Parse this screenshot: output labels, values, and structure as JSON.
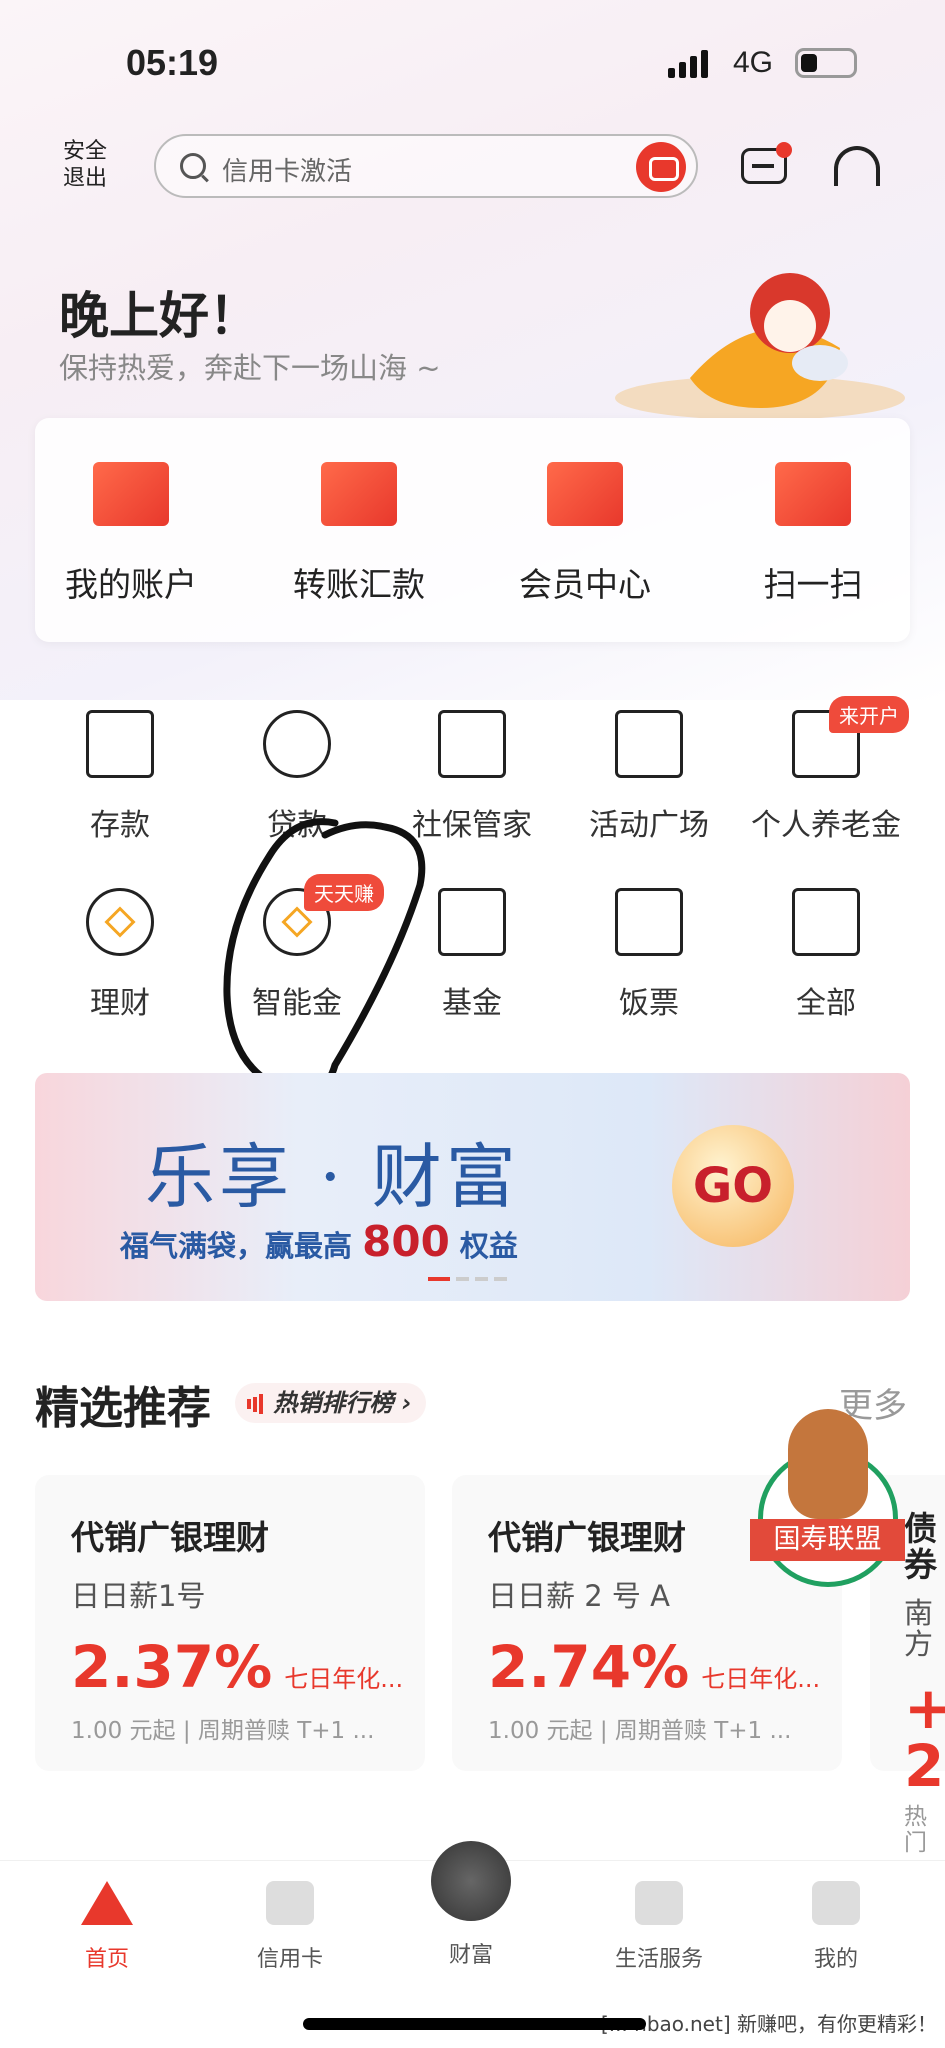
{
  "status_bar": {
    "time": "05:19",
    "network": "4G",
    "battery_level": 0.2
  },
  "header": {
    "logout_label": "安全\n退出",
    "logout_line1": "安全",
    "logout_line2": "退出",
    "search_placeholder": "信用卡激活",
    "message_has_badge": true
  },
  "greeting": {
    "title": "晚上好！",
    "subtitle": "保持热爱，奔赴下一场山海 ~"
  },
  "quick_actions": [
    {
      "label": "我的账户",
      "icon": "wallet-icon"
    },
    {
      "label": "转账汇款",
      "icon": "transfer-icon"
    },
    {
      "label": "会员中心",
      "icon": "crown-icon"
    },
    {
      "label": "扫一扫",
      "icon": "scan-icon"
    }
  ],
  "grid": [
    {
      "label": "存款",
      "icon": "deposit-icon"
    },
    {
      "label": "贷款",
      "icon": "loan-icon"
    },
    {
      "label": "社保管家",
      "icon": "social-security-icon"
    },
    {
      "label": "活动广场",
      "icon": "balloon-icon"
    },
    {
      "label": "个人养老金",
      "icon": "pension-house-icon",
      "badge": "来开户"
    },
    {
      "label": "理财",
      "icon": "wealth-coin-icon"
    },
    {
      "label": "智能金",
      "icon": "money-bag-icon",
      "badge": "天天赚"
    },
    {
      "label": "基金",
      "icon": "fund-chart-icon"
    },
    {
      "label": "饭票",
      "icon": "meal-ticket-icon"
    },
    {
      "label": "全部",
      "icon": "all-grid-icon"
    }
  ],
  "banner": {
    "title": "乐享 · 财富",
    "subtitle_pre": "福气满袋，赢最高",
    "subtitle_num": "800",
    "subtitle_post": "权益",
    "go_label": "GO",
    "page_count": 4,
    "active_page": 1
  },
  "recommend": {
    "title": "精选推荐",
    "hot_label": "热销排行榜 ›",
    "more_label": "更多",
    "products": [
      {
        "title": "代销广银理财",
        "name": "日日薪1号",
        "rate": "2.37%",
        "rate_label": "七日年化...",
        "meta": "1.00 元起 | 周期普赎 T+1 ..."
      },
      {
        "title": "代销广银理财",
        "name": "日日薪 2 号 A",
        "rate": "2.74%",
        "rate_label": "七日年化...",
        "meta": "1.00 元起 | 周期普赎 T+1 ..."
      },
      {
        "title": "债券",
        "name": "南方",
        "rate": "+2",
        "rate_label": "",
        "meta": "热门"
      }
    ]
  },
  "floating_badge": {
    "label": "国寿联盟"
  },
  "bottom_nav": [
    {
      "label": "首页",
      "active": true
    },
    {
      "label": "信用卡"
    },
    {
      "label": "财富"
    },
    {
      "label": "生活服务"
    },
    {
      "label": "我的"
    }
  ],
  "watermark": "[... nbao.net] 新赚吧，有你更精彩！",
  "colors": {
    "accent": "#e8382c",
    "banner_blue": "#2a5aa3",
    "badge": "#ef4b3b"
  }
}
